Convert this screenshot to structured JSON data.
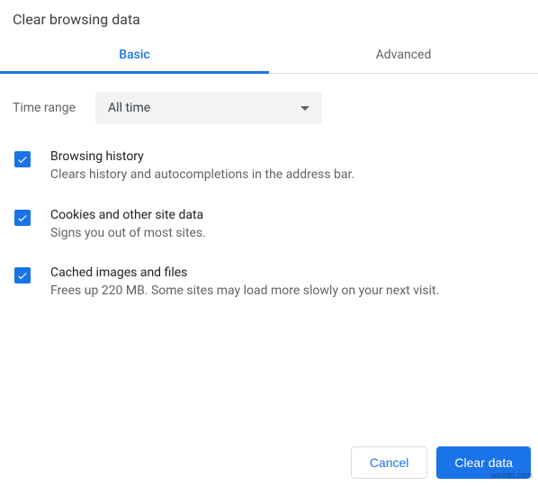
{
  "title": "Clear browsing data",
  "tabs": {
    "basic": "Basic",
    "advanced": "Advanced"
  },
  "time_range": {
    "label": "Time range",
    "value": "All time"
  },
  "options": {
    "browsing": {
      "title": "Browsing history",
      "desc": "Clears history and autocompletions in the address bar."
    },
    "cookies": {
      "title": "Cookies and other site data",
      "desc": "Signs you out of most sites."
    },
    "cache": {
      "title": "Cached images and files",
      "desc": "Frees up 220 MB. Some sites may load more slowly on your next visit."
    }
  },
  "buttons": {
    "cancel": "Cancel",
    "clear": "Clear data"
  },
  "watermark": "wsxdn.com"
}
